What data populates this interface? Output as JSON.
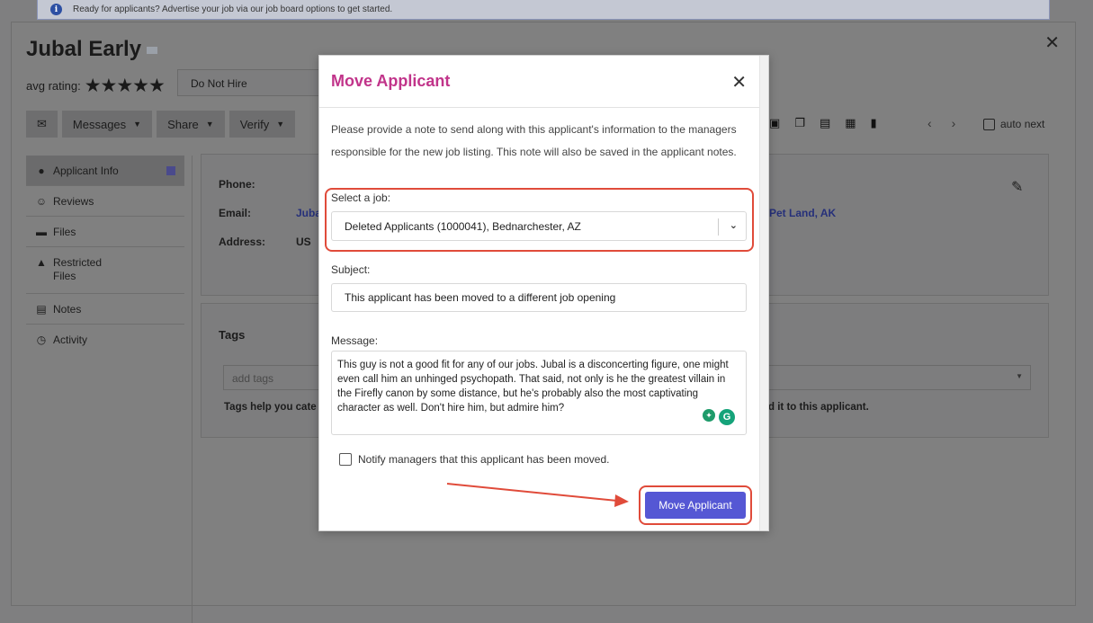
{
  "banner": {
    "text": "Ready for applicants? Advertise your job via our job board options to get started.",
    "info_icon": "i"
  },
  "applicant": {
    "name": "Jubal Early",
    "avg_rating_label": "avg rating:",
    "stars": "★★★★★",
    "status": "Do Not Hire"
  },
  "toolbar": {
    "messages": "Messages",
    "share": "Share",
    "verify": "Verify",
    "auto_next": "auto next"
  },
  "sidebar": {
    "items": [
      {
        "label": "Applicant Info",
        "icon": "user-circle-icon"
      },
      {
        "label": "Reviews",
        "icon": "user-check-icon"
      },
      {
        "label": "Files",
        "icon": "folder-icon"
      },
      {
        "label": "Restricted Files",
        "icon": "lock-icon"
      },
      {
        "label": "Notes",
        "icon": "clipboard-icon"
      },
      {
        "label": "Activity",
        "icon": "clock-icon"
      }
    ]
  },
  "info": {
    "phone_label": "Phone:",
    "email_label": "Email:",
    "email_value": "Juba",
    "address_label": "Address:",
    "address_value": "US",
    "location_value": "Pet Land, AK"
  },
  "tags": {
    "title": "Tags",
    "placeholder": "add tags",
    "help_start": "Tags help you cate",
    "help_end": "d it to this applicant."
  },
  "modal": {
    "title": "Move Applicant",
    "intro": "Please provide a note to send along with this applicant's information to the managers responsible for the new job listing. This note will also be saved in the applicant notes.",
    "job_label": "Select a job:",
    "job_value": "Deleted Applicants (1000041), Bednarchester, AZ",
    "subject_label": "Subject:",
    "subject_value": "This applicant has been moved to a different job opening",
    "message_label": "Message:",
    "message_value": "This guy is not a good fit for any of our jobs. Jubal is a disconcerting figure, one might even call him an unhinged psychopath. That said, not only is he the greatest villain in the Firefly canon by some distance, but he's probably also the most captivating character as well. Don't hire him, but admire him?",
    "notify_label": "Notify managers that this applicant has been moved.",
    "move_button": "Move Applicant"
  },
  "colors": {
    "modal_title": "#c1348a",
    "primary_button": "#5557d4",
    "highlight": "#e04b3a"
  }
}
